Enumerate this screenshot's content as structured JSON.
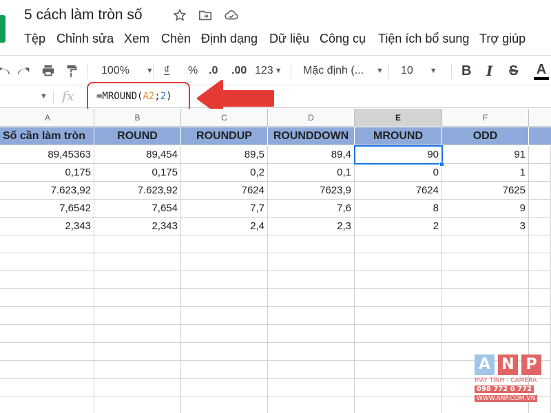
{
  "app": {
    "title": "5 cách làm tròn số",
    "icons": [
      "star-icon",
      "move-to-folder-icon",
      "cloud-saved-icon"
    ]
  },
  "menu": [
    "Tệp",
    "Chỉnh sửa",
    "Xem",
    "Chèn",
    "Định dạng",
    "Dữ liệu",
    "Công cụ",
    "Tiện ích bổ sung",
    "Trợ giúp"
  ],
  "toolbar": {
    "zoom": "100%",
    "currency": "₫",
    "percent": "%",
    "decrease_decimal": ".0",
    "increase_decimal": ".00",
    "more_formats": "123",
    "font": "Mặc định (...",
    "font_size": "10",
    "bold": "B",
    "italic": "I",
    "strikethrough": "S",
    "text_color": "A"
  },
  "formula_bar": {
    "fx": "fx",
    "formula_prefix": "=MROUND(",
    "formula_ref": "A2",
    "formula_sep": ";",
    "formula_arg": "2",
    "formula_suffix": ")"
  },
  "sheet": {
    "columns": [
      "A",
      "B",
      "C",
      "D",
      "E",
      "F"
    ],
    "active_column": "E",
    "headers": [
      "Số cần làm tròn",
      "ROUND",
      "ROUNDUP",
      "ROUNDDOWN",
      "MROUND",
      "ODD"
    ],
    "rows": [
      [
        "89,45363",
        "89,454",
        "89,5",
        "89,4",
        "90",
        "91"
      ],
      [
        "0,175",
        "0,175",
        "0,2",
        "0,1",
        "0",
        "1"
      ],
      [
        "7.623,92",
        "7.623,92",
        "7624",
        "7623,9",
        "7624",
        "7625"
      ],
      [
        "7,6542",
        "7,654",
        "7,7",
        "7,6",
        "8",
        "9"
      ],
      [
        "2,343",
        "2,343",
        "2,4",
        "2,3",
        "2",
        "3"
      ]
    ],
    "selected_cell": "E2"
  },
  "watermark": {
    "letters": [
      "A",
      "N",
      "P"
    ],
    "line1": "MÁY TÍNH - CAMERA",
    "line2": "098 772 0 772",
    "line3": "WWW.ANP.COM.VN"
  },
  "colors": {
    "header_fill": "#8eaadb",
    "selection": "#1a73e8",
    "annotation_red": "#e53935",
    "sheets_green": "#0f9d58"
  }
}
